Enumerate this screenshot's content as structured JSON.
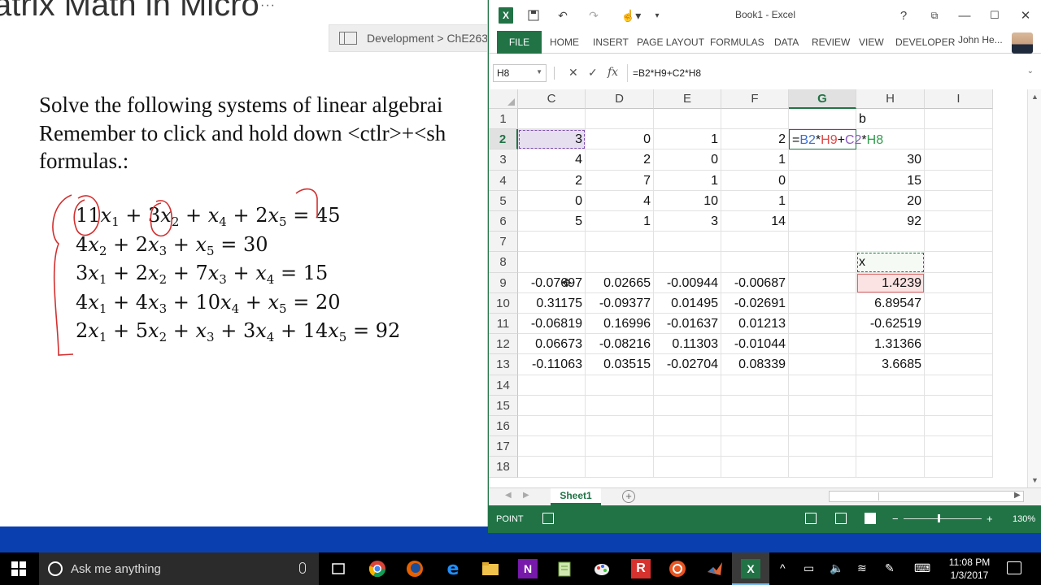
{
  "document": {
    "title_fragment": "atrix Math in Micro",
    "dots": "···",
    "tab_label": "Development > ChE263",
    "instruction_lines": [
      "Solve the following systems of linear algebrai",
      "Remember to click and hold down <ctlr>+<sh",
      "formulas.:"
    ]
  },
  "excel": {
    "window_title": "Book1 - Excel",
    "ribbon_tabs": [
      "FILE",
      "HOME",
      "INSERT",
      "PAGE LAYOUT",
      "FORMULAS",
      "DATA",
      "REVIEW",
      "VIEW",
      "DEVELOPER"
    ],
    "user_name": "John He...",
    "name_box": "H8",
    "formula": "=B2*H9+C2*H8",
    "columns": [
      "C",
      "D",
      "E",
      "F",
      "G",
      "H",
      "I"
    ],
    "selected_column": "G",
    "rows": [
      "1",
      "2",
      "3",
      "4",
      "5",
      "6",
      "7",
      "8",
      "9",
      "10",
      "11",
      "12",
      "13",
      "14",
      "15",
      "16",
      "17",
      "18"
    ],
    "selected_row": "2",
    "cells": {
      "H1": "b",
      "C2": "3",
      "D2": "0",
      "E2": "1",
      "F2": "2",
      "C3": "4",
      "D3": "2",
      "E3": "0",
      "F3": "1",
      "H3": "30",
      "C4": "2",
      "D4": "7",
      "E4": "1",
      "F4": "0",
      "H4": "15",
      "C5": "0",
      "D5": "4",
      "E5": "10",
      "F5": "1",
      "H5": "20",
      "C6": "5",
      "D6": "1",
      "E6": "3",
      "F6": "14",
      "H6": "92",
      "H8": "x",
      "C9": "-0.07697",
      "D9": "0.02665",
      "E9": "-0.00944",
      "F9": "-0.00687",
      "H9": "1.4239",
      "C10": "0.31175",
      "D10": "-0.09377",
      "E10": "0.01495",
      "F10": "-0.02691",
      "H10": "6.89547",
      "C11": "-0.06819",
      "D11": "0.16996",
      "E11": "-0.01637",
      "F11": "0.01213",
      "H11": "-0.62519",
      "C12": "0.06673",
      "D12": "-0.08216",
      "E12": "0.11303",
      "F12": "-0.01044",
      "H12": "1.31366",
      "C13": "-0.11063",
      "D13": "0.03515",
      "E13": "-0.02704",
      "F13": "0.08339",
      "H13": "3.6685"
    },
    "edit_cell": "G2",
    "edit_parts": [
      {
        "t": "=",
        "c": ""
      },
      {
        "t": "B2",
        "c": "ref-blue"
      },
      {
        "t": "*",
        "c": ""
      },
      {
        "t": "H9",
        "c": "ref-red"
      },
      {
        "t": "+",
        "c": ""
      },
      {
        "t": "C2",
        "c": "ref-purple"
      },
      {
        "t": "*",
        "c": ""
      },
      {
        "t": "H8",
        "c": "ref-green"
      }
    ],
    "sheet_tab": "Sheet1",
    "status_mode": "POINT",
    "zoom": "130%",
    "colors": {
      "accent": "#217346",
      "status_bar": "#217346"
    }
  },
  "taskbar": {
    "search_placeholder": "Ask me anything",
    "time": "11:08 PM",
    "date": "1/3/2017",
    "apps": [
      "task-view",
      "chrome",
      "firefox",
      "edge",
      "file-explorer",
      "onenote",
      "notepad",
      "paint",
      "r",
      "ubuntu",
      "matlab",
      "excel"
    ]
  }
}
